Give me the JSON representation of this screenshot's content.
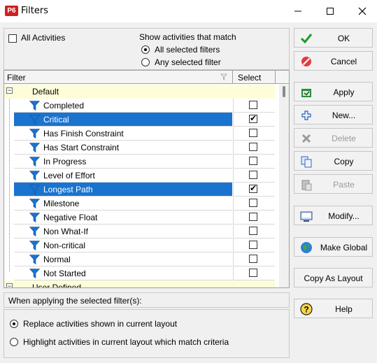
{
  "window": {
    "logo": "P6",
    "title": "Filters",
    "minimize_icon": "minimize-icon",
    "maximize_icon": "maximize-icon",
    "close_icon": "close-icon"
  },
  "options": {
    "all_activities_label": "All Activities",
    "all_activities_checked": false,
    "match_heading": "Show activities that match",
    "match_all_label": "All selected filters",
    "match_any_label": "Any selected filter",
    "match_selected": "all"
  },
  "grid": {
    "columns": {
      "filter": "Filter",
      "select": "Select"
    },
    "groups": [
      {
        "name": "Default",
        "expander": "⊟",
        "filters": [
          {
            "name": "Completed",
            "selected": false,
            "highlighted": false
          },
          {
            "name": "Critical",
            "selected": true,
            "highlighted": true
          },
          {
            "name": "Has Finish Constraint",
            "selected": false,
            "highlighted": false
          },
          {
            "name": "Has Start Constraint",
            "selected": false,
            "highlighted": false
          },
          {
            "name": "In Progress",
            "selected": false,
            "highlighted": false
          },
          {
            "name": "Level of Effort",
            "selected": false,
            "highlighted": false
          },
          {
            "name": "Longest Path",
            "selected": true,
            "highlighted": true
          },
          {
            "name": "Milestone",
            "selected": false,
            "highlighted": false
          },
          {
            "name": "Negative Float",
            "selected": false,
            "highlighted": false
          },
          {
            "name": "Non What-If",
            "selected": false,
            "highlighted": false
          },
          {
            "name": "Non-critical",
            "selected": false,
            "highlighted": false
          },
          {
            "name": "Normal",
            "selected": false,
            "highlighted": false
          },
          {
            "name": "Not Started",
            "selected": false,
            "highlighted": false
          }
        ]
      },
      {
        "name": "User Defined",
        "expander": "⊟",
        "filters": []
      }
    ]
  },
  "apply_section": {
    "heading": "When applying the selected filter(s):",
    "replace_label": "Replace activities shown in current layout",
    "highlight_label": "Highlight activities in current layout which match criteria",
    "mode_selected": "replace"
  },
  "buttons": [
    {
      "key": "ok",
      "label": "OK",
      "icon": "check-icon",
      "enabled": true
    },
    {
      "key": "cancel",
      "label": "Cancel",
      "icon": "cancel-icon",
      "enabled": true
    },
    {
      "key": "apply",
      "label": "Apply",
      "icon": "apply-icon",
      "enabled": true
    },
    {
      "key": "new",
      "label": "New...",
      "icon": "plus-icon",
      "enabled": true
    },
    {
      "key": "delete",
      "label": "Delete",
      "icon": "delete-x-icon",
      "enabled": false
    },
    {
      "key": "copy",
      "label": "Copy",
      "icon": "copy-icon",
      "enabled": true
    },
    {
      "key": "paste",
      "label": "Paste",
      "icon": "paste-icon",
      "enabled": false
    },
    {
      "key": "modify",
      "label": "Modify...",
      "icon": "modify-icon",
      "enabled": true
    },
    {
      "key": "make_global",
      "label": "Make Global",
      "icon": "globe-icon",
      "enabled": true
    },
    {
      "key": "copy_as_layout",
      "label": "Copy As Layout",
      "icon": "",
      "enabled": true
    },
    {
      "key": "help",
      "label": "Help",
      "icon": "help-icon",
      "enabled": true
    }
  ],
  "colors": {
    "selection": "#1a73cf",
    "group_row": "#fdfdd9",
    "funnel": "#1a73cf",
    "logo": "#d21f1f"
  }
}
